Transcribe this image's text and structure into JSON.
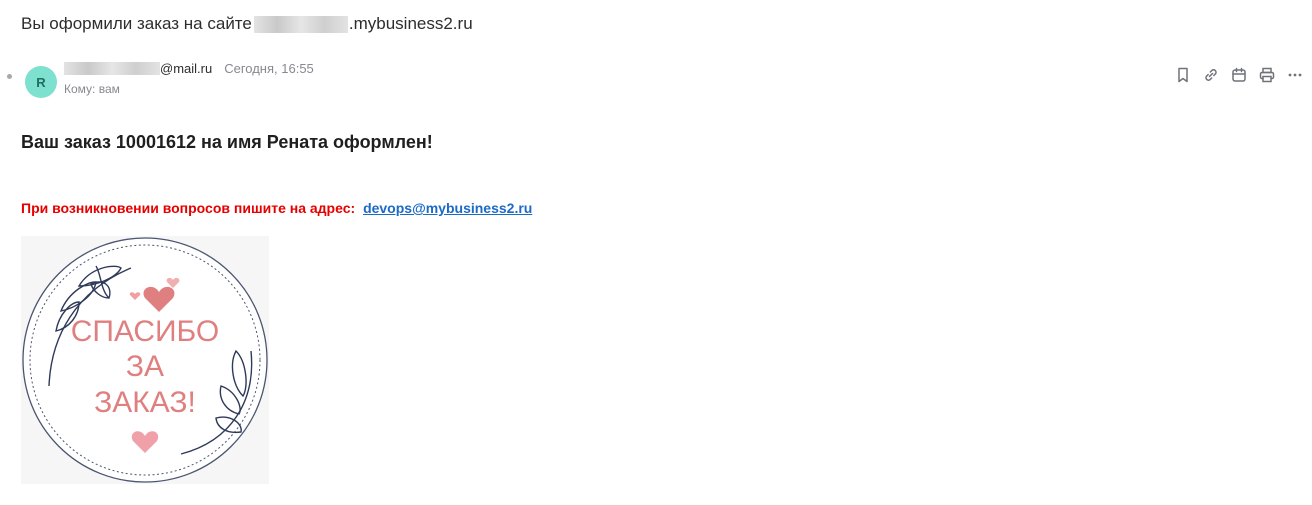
{
  "subject": {
    "prefix": "Вы оформили заказ на сайте ",
    "domain_suffix": ".mybusiness2.ru"
  },
  "sender": {
    "avatar_letter": "R",
    "email_domain": "@mail.ru",
    "date": "Сегодня, 16:55",
    "to": "Кому: вам"
  },
  "toolbar": {
    "icons": [
      "bookmark-icon",
      "link-icon",
      "calendar-icon",
      "print-icon",
      "more-icon"
    ]
  },
  "body": {
    "headline": "Ваш заказ 10001612 на имя Рената оформлен!",
    "contact_text": "При возникновении вопросов пишите на адрес:",
    "contact_email": "devops@mybusiness2.ru"
  },
  "image": {
    "line1": "СПАСИБО",
    "line2": "ЗА",
    "line3": "ЗАКАЗ!"
  },
  "colors": {
    "avatar": "#7ee0cf",
    "contact_red": "#e60000",
    "link_blue": "#1b6ac6",
    "script_pink": "#e07f7f",
    "leaf_navy": "#2f3a5a"
  }
}
